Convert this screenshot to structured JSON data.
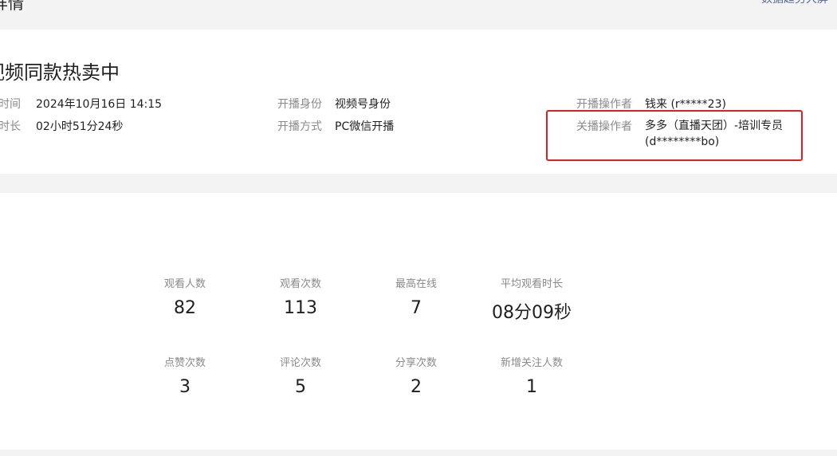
{
  "header": {
    "title": "播详情",
    "trend_link": "数据趋势大屏"
  },
  "live": {
    "title": "视频同款热卖中",
    "fields": {
      "start_time": {
        "label": "开播时间",
        "value": "2024年10月16日 14:15"
      },
      "duration": {
        "label": "直播时长",
        "value": "02小时51分24秒"
      },
      "identity": {
        "label": "开播身份",
        "value": "视频号身份"
      },
      "method": {
        "label": "开播方式",
        "value": "PC微信开播"
      },
      "start_operator": {
        "label": "开播操作者",
        "value": "钱来 (r*****23)"
      },
      "end_operator": {
        "label": "关播操作者",
        "value_line1": "多多（直播天团）-培训专员",
        "value_line2": "(d********bo)"
      }
    },
    "highlight_color": "#e02020"
  },
  "stats": [
    {
      "label": "观看人数",
      "value": "82"
    },
    {
      "label": "观看次数",
      "value": "113"
    },
    {
      "label": "最高在线",
      "value": "7"
    },
    {
      "label": "平均观看时长",
      "value": "08分09秒"
    },
    {
      "label": "点赞次数",
      "value": "3"
    },
    {
      "label": "评论次数",
      "value": "5"
    },
    {
      "label": "分享次数",
      "value": "2"
    },
    {
      "label": "新增关注人数",
      "value": "1"
    }
  ]
}
